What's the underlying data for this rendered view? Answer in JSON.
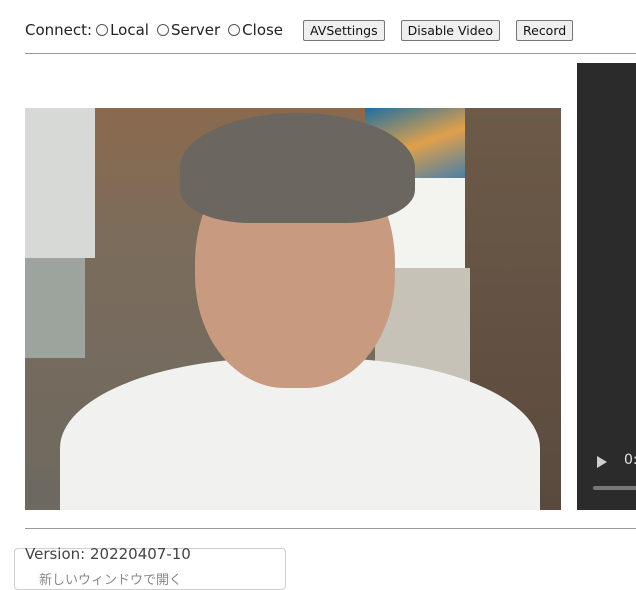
{
  "connect": {
    "label": "Connect:",
    "options": [
      "Local",
      "Server",
      "Close"
    ]
  },
  "buttons": {
    "av_settings": "AVSettings",
    "disable_video": "Disable Video",
    "record": "Record"
  },
  "remote_video": {
    "time_text": "0:"
  },
  "version": "Version: 20220407-10",
  "popup": {
    "item": "新しいウィンドウで開く"
  }
}
